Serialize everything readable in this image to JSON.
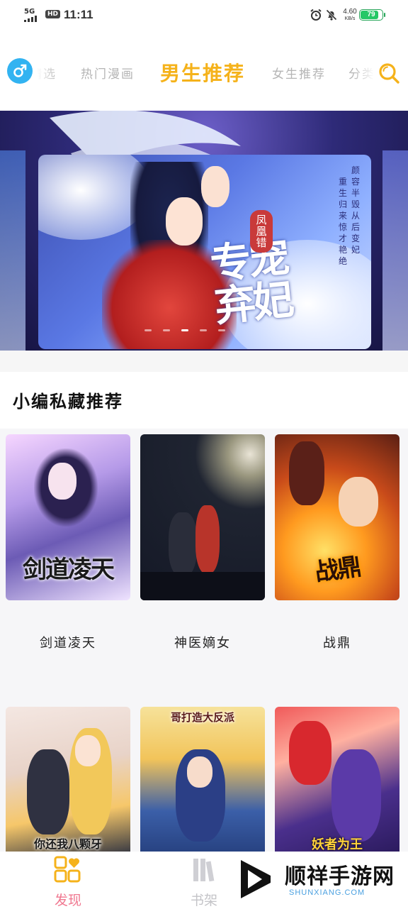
{
  "status_bar": {
    "network": "5G",
    "hd": "HD",
    "time": "11:11",
    "speed_value": "4.60",
    "speed_unit": "KB/s",
    "battery": "79",
    "battery_level": 0.79,
    "alarm_icon": "alarm-clock-icon",
    "mute_icon": "bell-off-icon"
  },
  "top_nav": {
    "gender_icon": "male-symbol-icon",
    "tabs": [
      {
        "label": "精选",
        "visible_text": "精选"
      },
      {
        "label": "热门漫画"
      },
      {
        "label": "男生推荐",
        "active": true
      },
      {
        "label": "女生推荐"
      },
      {
        "label": "分类"
      }
    ],
    "search_icon": "search-icon",
    "accent_color": "#f5b21a",
    "gender_color": "#32b3f1"
  },
  "banner": {
    "title": "专宠弃妃",
    "subtitle": "凤凰错",
    "tagline": [
      "颜容半毁从后变妃",
      "重生归来惊才艳绝"
    ],
    "slide_count": 5,
    "active_slide": 2
  },
  "section": {
    "title": "小编私藏推荐"
  },
  "comics": [
    {
      "title": "剑道凌天",
      "cover_text": "剑道凌天"
    },
    {
      "title": "神医嫡女",
      "cover_text": ""
    },
    {
      "title": "战鼎",
      "cover_text": "战鼎"
    },
    {
      "title": "",
      "cover_text": "你还我八颗牙"
    },
    {
      "title": "",
      "cover_text": "哥打造大反派"
    },
    {
      "title": "",
      "cover_text": "妖者为王"
    }
  ],
  "bottom_nav": {
    "items": [
      {
        "label": "发现",
        "icon": "discover-icon",
        "active": true
      },
      {
        "label": "书架",
        "icon": "bookshelf-icon",
        "active": false
      }
    ],
    "active_color": "#f5b21a"
  },
  "watermark": {
    "text": "顺祥手游网",
    "url": "SHUNXIANG.COM",
    "icon": "play-logo-icon"
  }
}
